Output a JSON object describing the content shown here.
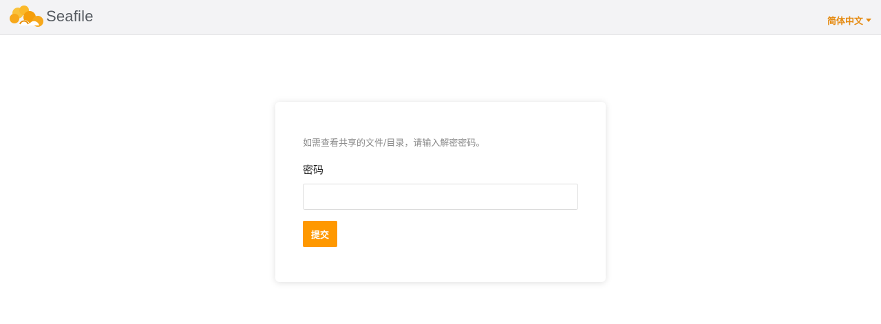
{
  "header": {
    "logo_text": "Seafile",
    "logo_icon": "seafile-cloud-logo",
    "language_label": "简体中文",
    "language_icon": "caret-down-icon"
  },
  "form": {
    "intro": "如需查看共享的文件/目录，请输入解密密码。",
    "password_label": "密码",
    "password_value": "",
    "submit_label": "提交"
  },
  "colors": {
    "accent": "#ff9800",
    "language_link": "#e58a10",
    "topbar_bg": "#f3f3f5"
  }
}
